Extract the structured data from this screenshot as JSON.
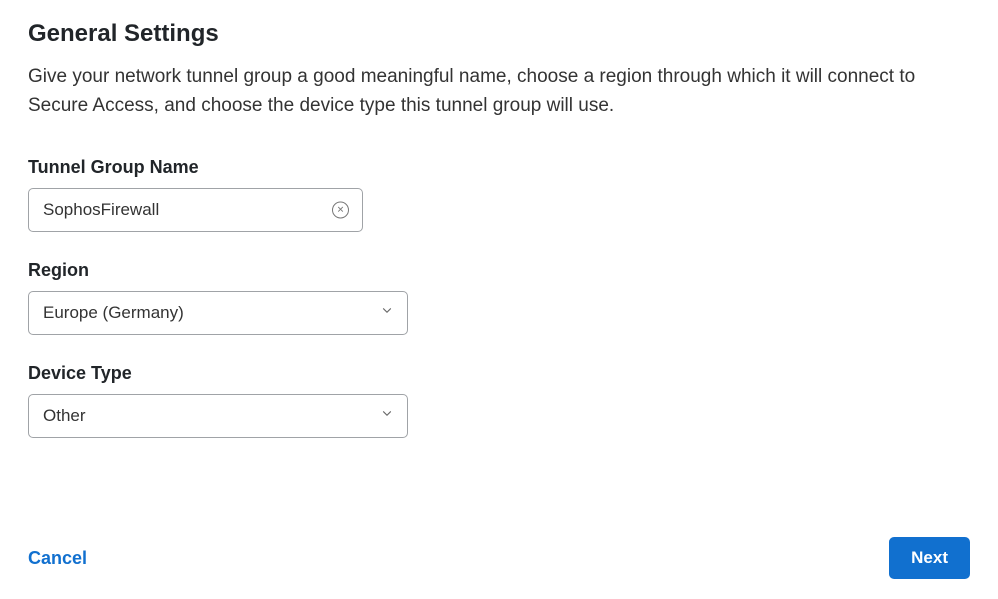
{
  "header": {
    "title": "General Settings",
    "description": "Give your network tunnel group a good meaningful name, choose a region through which it will connect to Secure Access, and choose the device type this tunnel group will use."
  },
  "fields": {
    "tunnelGroupName": {
      "label": "Tunnel Group Name",
      "value": "SophosFirewall"
    },
    "region": {
      "label": "Region",
      "value": "Europe (Germany)"
    },
    "deviceType": {
      "label": "Device Type",
      "value": "Other"
    }
  },
  "footer": {
    "cancel": "Cancel",
    "next": "Next"
  }
}
